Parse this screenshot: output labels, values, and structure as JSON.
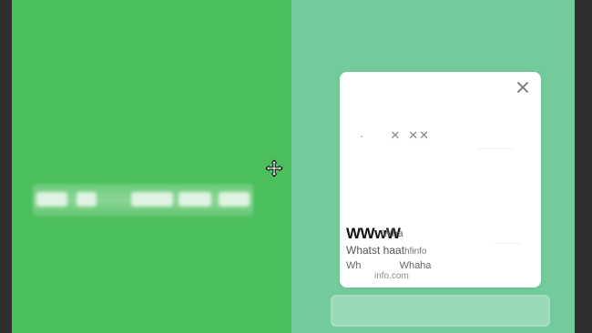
{
  "colors": {
    "left_panel": "#4cbf5d",
    "right_panel": "#73cb9c",
    "card": "#ffffff",
    "frame": "#2e2e2e"
  },
  "icons": {
    "cursor": "move-cursor-icon",
    "close": "close-icon"
  },
  "card": {
    "glyphs": [
      "·",
      "✕",
      "✕✕"
    ],
    "wide_title": "WWwW",
    "overlay_small": "Wha",
    "subline": "Whatst haat",
    "subline_tail": "hfinfo",
    "line3_a": "Wh",
    "line3_b": "Whaha",
    "url": "info.com"
  },
  "bottom_button": {
    "label": ""
  }
}
